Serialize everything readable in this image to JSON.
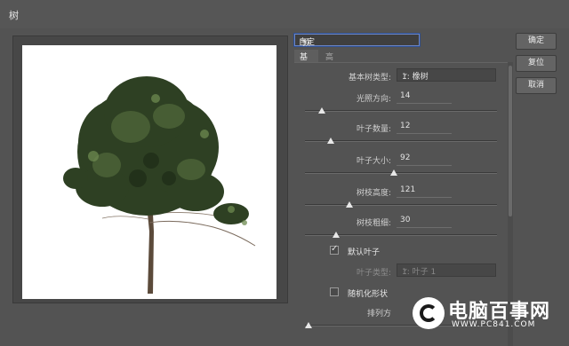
{
  "window": {
    "title": "树"
  },
  "preset": {
    "label": "预设:",
    "value": "自定"
  },
  "tabs": [
    {
      "label": "基本"
    },
    {
      "label": "高级"
    }
  ],
  "fields": {
    "base_tree_type": {
      "label": "基本树类型:",
      "value": "1: 橡树"
    },
    "light_direction": {
      "label": "光照方向:",
      "value": "14",
      "slider_fraction": 0.07
    },
    "leaf_count": {
      "label": "叶子数量:",
      "value": "12",
      "slider_fraction": 0.12
    },
    "leaf_size": {
      "label": "叶子大小:",
      "value": "92",
      "slider_fraction": 0.46
    },
    "branch_height": {
      "label": "树枝高度:",
      "value": "121",
      "slider_fraction": 0.22
    },
    "branch_thickness": {
      "label": "树枝粗细:",
      "value": "30",
      "slider_fraction": 0.15
    },
    "default_leaves": {
      "label": "默认叶子",
      "checked": true
    },
    "leaf_type": {
      "label": "叶子类型:",
      "value": "1: 叶子 1",
      "disabled": true
    },
    "randomize_shapes": {
      "label": "随机化形状",
      "checked": false
    },
    "arrangement": {
      "label": "排列方",
      "slider_fraction": 0.0
    }
  },
  "buttons": {
    "ok": "确定",
    "reset": "复位",
    "cancel": "取消"
  },
  "watermark": {
    "name": "电脑百事网",
    "url": "WWW.PC841.COM"
  },
  "colors": {
    "dialog_bg": "#535353",
    "focus_border": "#6b86c7",
    "foliage": "#2e4023"
  }
}
